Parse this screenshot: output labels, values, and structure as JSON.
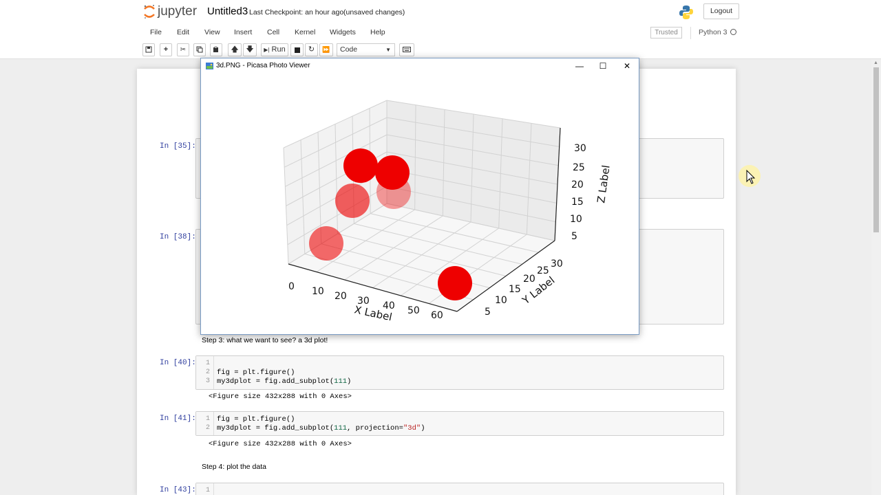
{
  "header": {
    "logo_text": "jupyter",
    "notebook_name": "Untitled3",
    "checkpoint": "Last Checkpoint: an hour ago",
    "unsaved": "(unsaved changes)",
    "logout": "Logout"
  },
  "menubar": {
    "items": [
      "File",
      "Edit",
      "View",
      "Insert",
      "Cell",
      "Kernel",
      "Widgets",
      "Help"
    ],
    "trusted": "Trusted",
    "kernel": "Python 3"
  },
  "toolbar": {
    "run_label": "Run",
    "cell_type": "Code"
  },
  "picasa": {
    "title": "3d.PNG - Picasa Photo Viewer",
    "minimize": "—",
    "maximize": "☐",
    "close": "✕"
  },
  "notebook": {
    "cells": [
      {
        "prompt": "In [35]:"
      },
      {
        "prompt": "In [38]:"
      },
      {
        "markdown": "Step 3: what we want to see? a 3d plot!"
      },
      {
        "prompt": "In [40]:",
        "lines": [
          "",
          "fig = plt.figure()",
          "my3dplot = fig.add_subplot(111)"
        ],
        "output": "<Figure size 432x288 with 0 Axes>"
      },
      {
        "prompt": "In [41]:",
        "lines": [
          "fig = plt.figure()",
          "my3dplot = fig.add_subplot(111, projection=\"3d\")"
        ],
        "output": "<Figure size 432x288 with 0 Axes>"
      },
      {
        "markdown": "Step 4: plot the data"
      },
      {
        "prompt": "In [43]:",
        "lines": [
          ""
        ]
      }
    ]
  },
  "chart_data": {
    "type": "scatter",
    "projection": "3d",
    "xlabel": "X Label",
    "ylabel": "Y Label",
    "zlabel": "Z Label",
    "xticks": [
      "0",
      "10",
      "20",
      "30",
      "40",
      "50",
      "60"
    ],
    "yticks": [
      "5",
      "10",
      "15",
      "20",
      "25",
      "30"
    ],
    "zticks": [
      "5",
      "10",
      "15",
      "20",
      "25",
      "30"
    ],
    "color": "#ee0000",
    "grid": true
  }
}
